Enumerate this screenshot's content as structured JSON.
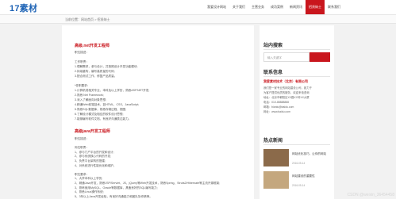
{
  "header": {
    "logo": "17素材",
    "nav": [
      "我爱设计网站",
      "关于我们",
      "主营业务",
      "成功案例",
      "新闻资讯",
      "招贤纳士",
      "联系我们"
    ],
    "active_index": 5
  },
  "breadcrumb": "当前位置：网站首页 > 招贤纳士",
  "main": {
    "job1_title": "高级.net开发工程师",
    "job1_lines": [
      "职位描述：",
      "",
      "工作职责：",
      "1.理解需求，参与设计，并按照设计开发功能模块;",
      "2.持续重构，编写高质量的代码;",
      "3.配合测试工作，修复产品质量。",
      "",
      "*任职要求：",
      "1.计算机或相关专业，本科及以上学历，熟悉ASP.NET开发;",
      "2.熟悉.Net Framework;",
      "3.深入了解面向对象思想;",
      "4.精通Web前端技术，如HTML、CSS、JavaScript;",
      "5.熟悉SQL数据库，熟悉存储过程、视图;",
      "6.了解设计模式及相应的软件设计思想;",
      "7.能够编写软件文档，有良好沟通表达能力。"
    ],
    "job2_title": "高级java开发工程师",
    "job2_lines": [
      "职位描述：",
      "",
      "岗位职责：",
      "1、参与门户平台的开发和设计;",
      "2、参与系统核心代码的开发;",
      "3、负责平台架构的搭建;",
      "4、对系统进行性能优化和维护。",
      "",
      "职位要求：",
      "1、大学本科以上学历;",
      "2、精通Java开发，熟悉JSP/Servlet、JS、jQuery等Web开发技术，熟悉Spring、Struts2/Hibernate等主流开源框架;",
      "3、熟练使用MySQL、Oracle等数据库，具备良好的SQL编写能力;",
      "4、熟悉Linux操作系统;",
      "5、3年以上Java开发经验，有良好沟通能力和团队协作精神。"
    ]
  },
  "sidebar": {
    "search_title": "站内搜索",
    "search_placeholder": "输入关键字",
    "contact_title": "联系信息",
    "company": "我爱素材技术（北京）有限公司",
    "contact_lines": [
      "我们是一家专业的网站建设公司，致力于",
      "为客户提供优质的服务，欢迎来电咨询",
      "地址：北京市朝阳区XX路XX号XX大厦",
      "电话：010-88888888",
      "邮箱：bianlu@baidu.com",
      "网址：www.baidu.com"
    ],
    "news_title": "热点新闻",
    "news": [
      {
        "text": "网站优化技巧，让你的网站",
        "date": "2016-05-14"
      },
      {
        "text": "网站建设的重要性",
        "date": "2016-05-14"
      }
    ],
    "img1_color": "#8b6a4a",
    "img2_color": "#c4a77e"
  },
  "watermark": "CSDN @weixin_36454458",
  "colors": {
    "accent": "#c9161d",
    "logo": "#1e63b5"
  }
}
